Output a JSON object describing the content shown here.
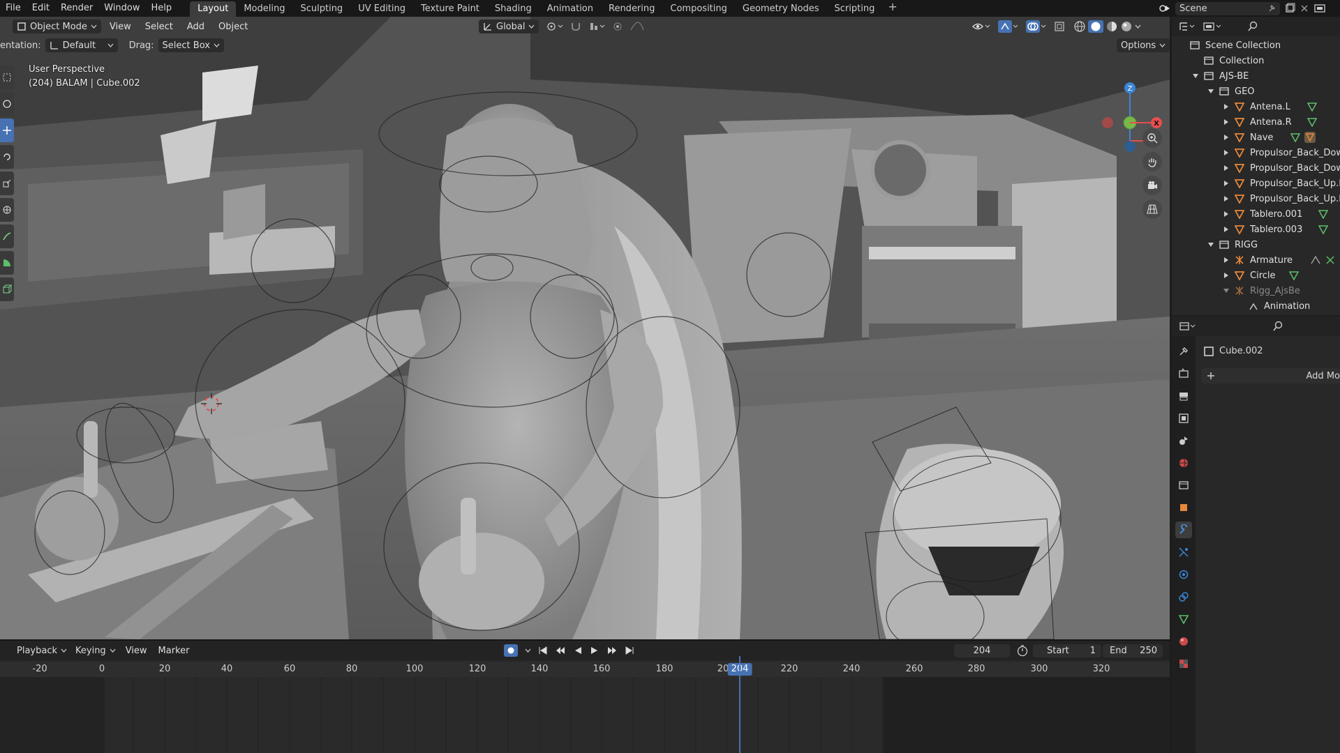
{
  "menu": [
    "File",
    "Edit",
    "Render",
    "Window",
    "Help"
  ],
  "workspaces": [
    {
      "label": "Layout",
      "active": true
    },
    {
      "label": "Modeling"
    },
    {
      "label": "Sculpting"
    },
    {
      "label": "UV Editing"
    },
    {
      "label": "Texture Paint"
    },
    {
      "label": "Shading"
    },
    {
      "label": "Animation"
    },
    {
      "label": "Rendering"
    },
    {
      "label": "Compositing"
    },
    {
      "label": "Geometry Nodes"
    },
    {
      "label": "Scripting"
    }
  ],
  "add_workspace": "+",
  "scene_name": "Scene",
  "viewport": {
    "mode": "Object Mode",
    "menus": [
      "View",
      "Select",
      "Add",
      "Object"
    ],
    "transform_orientation": "Global",
    "orientation_label": "entation:",
    "orientation_value": "Default",
    "drag_label": "Drag:",
    "drag_value": "Select Box",
    "options_label": "Options",
    "perspective": "User Perspective",
    "active_info": "(204) BALAM | Cube.002",
    "gizmo": {
      "x": "X",
      "y": "Y",
      "z": "Z"
    }
  },
  "timeline": {
    "menus": [
      "Playback",
      "Keying",
      "View",
      "Marker"
    ],
    "current_frame": "204",
    "start_label": "Start",
    "start_value": "1",
    "end_label": "End",
    "end_value": "250",
    "ticks": [
      "-20",
      "0",
      "20",
      "40",
      "60",
      "80",
      "100",
      "120",
      "140",
      "160",
      "180",
      "20",
      "220",
      "240",
      "260",
      "280",
      "300",
      "320"
    ],
    "playhead_label": "204"
  },
  "outliner": {
    "rows": [
      {
        "label": "Scene Collection",
        "type": "scene"
      },
      {
        "label": "Collection",
        "type": "collection"
      },
      {
        "label": "AJS-BE",
        "type": "collection"
      },
      {
        "label": "GEO",
        "type": "collection"
      },
      {
        "label": "Antena.L",
        "type": "mesh"
      },
      {
        "label": "Antena.R",
        "type": "mesh"
      },
      {
        "label": "Nave",
        "type": "mesh"
      },
      {
        "label": "Propulsor_Back_Down",
        "type": "mesh"
      },
      {
        "label": "Propulsor_Back_Down",
        "type": "mesh"
      },
      {
        "label": "Propulsor_Back_Up.L",
        "type": "mesh"
      },
      {
        "label": "Propulsor_Back_Up.R",
        "type": "mesh"
      },
      {
        "label": "Tablero.001",
        "type": "mesh"
      },
      {
        "label": "Tablero.003",
        "type": "mesh"
      },
      {
        "label": "RIGG",
        "type": "collection"
      },
      {
        "label": "Armature",
        "type": "armature"
      },
      {
        "label": "Circle",
        "type": "mesh"
      },
      {
        "label": "Rigg_AjsBe",
        "type": "armature"
      },
      {
        "label": "Animation",
        "type": "anim"
      }
    ]
  },
  "properties": {
    "object_name": "Cube.002",
    "add_modifier": "Add Mo"
  },
  "colors": {
    "accent": "#4772b3",
    "mesh_icon": "#e8883a",
    "data_icon": "#5fbf6a",
    "x_axis": "#e84e4e",
    "y_axis": "#78b84a",
    "z_axis": "#3a86d6"
  }
}
